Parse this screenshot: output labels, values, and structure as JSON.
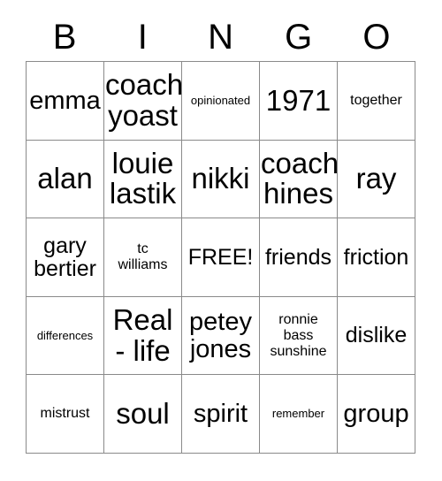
{
  "card": {
    "header_letters": [
      "B",
      "I",
      "N",
      "G",
      "O"
    ],
    "free_space_label": "FREE!",
    "colors": {
      "background": "#ffffff",
      "text": "#000000",
      "grid_line": "#8a8a8a"
    },
    "rows": [
      [
        {
          "text": "emma",
          "size": "xl"
        },
        {
          "text": "coach\nyoast",
          "size": "xxl"
        },
        {
          "text": "opinionated",
          "size": "xs"
        },
        {
          "text": "1971",
          "size": "xxl"
        },
        {
          "text": "together",
          "size": "s"
        }
      ],
      [
        {
          "text": "alan",
          "size": "xxl"
        },
        {
          "text": "louie\nlastik",
          "size": "xxl"
        },
        {
          "text": "nikki",
          "size": "xxl"
        },
        {
          "text": "coach\nhines",
          "size": "xxl"
        },
        {
          "text": "ray",
          "size": "xxl"
        }
      ],
      [
        {
          "text": "gary\nbertier",
          "size": "l"
        },
        {
          "text": "tc\nwilliams",
          "size": "s"
        },
        {
          "text": "FREE!",
          "size": "l"
        },
        {
          "text": "friends",
          "size": "l"
        },
        {
          "text": "friction",
          "size": "l"
        }
      ],
      [
        {
          "text": "differences",
          "size": "xs"
        },
        {
          "text": "Real\n- life",
          "size": "xxl"
        },
        {
          "text": "petey\njones",
          "size": "xl"
        },
        {
          "text": "ronnie\nbass\nsunshine",
          "size": "s"
        },
        {
          "text": "dislike",
          "size": "l"
        }
      ],
      [
        {
          "text": "mistrust",
          "size": "s"
        },
        {
          "text": "soul",
          "size": "xxl"
        },
        {
          "text": "spirit",
          "size": "xl"
        },
        {
          "text": "remember",
          "size": "xs"
        },
        {
          "text": "group",
          "size": "xl"
        }
      ]
    ]
  }
}
